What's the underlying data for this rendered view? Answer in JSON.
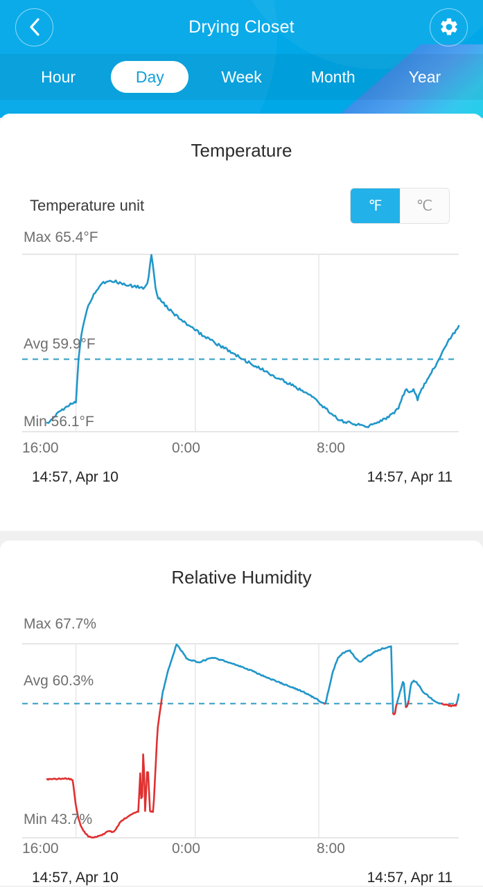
{
  "header": {
    "title": "Drying Closet",
    "back_icon": "chevron-left-icon",
    "settings_icon": "gear-icon",
    "bg_color": "#00a8e8",
    "tabs": [
      {
        "label": "Hour",
        "active": false
      },
      {
        "label": "Day",
        "active": true
      },
      {
        "label": "Week",
        "active": false
      },
      {
        "label": "Month",
        "active": false
      },
      {
        "label": "Year",
        "active": false
      }
    ]
  },
  "temperature_card": {
    "title": "Temperature",
    "unit_setting_label": "Temperature unit",
    "unit_options": [
      {
        "label": "℉",
        "selected": true
      },
      {
        "label": "℃",
        "selected": false
      }
    ],
    "max_label": "Max 65.4°F",
    "avg_label": "Avg 59.9°F",
    "min_label": "Min 56.1°F",
    "x_ticks": [
      "16:00",
      "0:00",
      "8:00"
    ],
    "range_start": "14:57,  Apr 10",
    "range_end": "14:57,  Apr 11",
    "line_color": "#2196c9",
    "avg_line_color": "#2e9bc4"
  },
  "humidity_card": {
    "title": "Relative Humidity",
    "max_label": "Max 67.7%",
    "avg_label": "Avg 60.3%",
    "min_label": "Min 43.7%",
    "x_ticks": [
      "16:00",
      "0:00",
      "8:00"
    ],
    "range_start": "14:57,  Apr 10",
    "range_end": "14:57,  Apr 11",
    "line_color": "#2196c9",
    "below_avg_color": "#e03030",
    "avg_line_color": "#2e9bc4"
  },
  "chart_data": [
    {
      "type": "line",
      "title": "Temperature",
      "xlabel": "",
      "ylabel": "°F",
      "unit": "°F",
      "max": 65.4,
      "avg": 59.9,
      "min": 56.1,
      "ylim": [
        56.1,
        65.4
      ],
      "x_tick_labels": [
        "16:00",
        "0:00",
        "8:00"
      ],
      "x_tick_positions": [
        0.07,
        0.36,
        0.66
      ],
      "x_start": "14:57, Apr 10",
      "x_end": "14:57, Apr 11",
      "grid": true,
      "legend": "none",
      "avg_reference_line": 59.9,
      "x": [
        0.0,
        0.018,
        0.036,
        0.05,
        0.062,
        0.07,
        0.074,
        0.078,
        0.082,
        0.09,
        0.1,
        0.115,
        0.13,
        0.15,
        0.17,
        0.19,
        0.205,
        0.22,
        0.235,
        0.245,
        0.253,
        0.258,
        0.263,
        0.27,
        0.28,
        0.295,
        0.315,
        0.34,
        0.365,
        0.39,
        0.42,
        0.45,
        0.48,
        0.51,
        0.545,
        0.58,
        0.615,
        0.65,
        0.672,
        0.69,
        0.705,
        0.72,
        0.74,
        0.76,
        0.78,
        0.8,
        0.82,
        0.84,
        0.855,
        0.865,
        0.872,
        0.88,
        0.89,
        0.9,
        0.915,
        0.935,
        0.955,
        0.975,
        1.0
      ],
      "y": [
        56.55,
        56.95,
        57.2,
        57.45,
        57.6,
        57.7,
        59.05,
        60.35,
        61.0,
        61.85,
        62.75,
        63.35,
        63.85,
        64.05,
        63.95,
        63.8,
        63.75,
        63.7,
        63.6,
        63.9,
        65.4,
        64.65,
        63.65,
        63.15,
        62.9,
        62.55,
        62.15,
        61.7,
        61.35,
        61.0,
        60.6,
        60.25,
        59.85,
        59.5,
        59.1,
        58.7,
        58.3,
        57.85,
        57.4,
        57.05,
        56.8,
        56.65,
        56.55,
        56.45,
        56.4,
        56.55,
        56.75,
        57.05,
        57.4,
        58.0,
        58.35,
        58.1,
        58.35,
        57.8,
        58.55,
        59.25,
        60.0,
        60.9,
        61.6
      ]
    },
    {
      "type": "line",
      "title": "Relative Humidity",
      "xlabel": "",
      "ylabel": "%",
      "unit": "%",
      "max": 67.7,
      "avg": 60.3,
      "min": 43.7,
      "ylim": [
        43.7,
        67.7
      ],
      "x_tick_labels": [
        "16:00",
        "0:00",
        "8:00"
      ],
      "x_tick_positions": [
        0.07,
        0.36,
        0.66
      ],
      "x_start": "14:57, Apr 10",
      "x_end": "14:57, Apr 11",
      "grid": true,
      "legend": "none",
      "avg_reference_line": 60.3,
      "split_color_at_avg": true,
      "x": [
        0.0,
        0.01,
        0.02,
        0.03,
        0.042,
        0.055,
        0.062,
        0.066,
        0.07,
        0.076,
        0.084,
        0.092,
        0.1,
        0.11,
        0.12,
        0.13,
        0.14,
        0.15,
        0.162,
        0.172,
        0.18,
        0.186,
        0.19,
        0.194,
        0.198,
        0.202,
        0.206,
        0.21,
        0.214,
        0.218,
        0.222,
        0.226,
        0.23,
        0.234,
        0.238,
        0.244,
        0.25,
        0.258,
        0.268,
        0.28,
        0.295,
        0.315,
        0.34,
        0.37,
        0.4,
        0.43,
        0.465,
        0.5,
        0.54,
        0.58,
        0.62,
        0.65,
        0.668,
        0.676,
        0.684,
        0.694,
        0.706,
        0.72,
        0.735,
        0.748,
        0.76,
        0.772,
        0.786,
        0.8,
        0.815,
        0.828,
        0.836,
        0.84,
        0.844,
        0.848,
        0.854,
        0.86,
        0.866,
        0.872,
        0.878,
        0.884,
        0.89,
        0.896,
        0.904,
        0.912,
        0.922,
        0.934,
        0.948,
        0.962,
        0.974,
        0.982,
        0.988,
        0.994,
        1.0
      ],
      "y": [
        50.9,
        51.0,
        50.95,
        51.0,
        51.05,
        50.95,
        50.9,
        49.2,
        47.6,
        46.1,
        44.9,
        44.3,
        43.9,
        43.7,
        43.8,
        44.0,
        44.25,
        44.55,
        44.4,
        45.2,
        45.8,
        46.0,
        46.1,
        46.25,
        46.4,
        46.55,
        46.65,
        46.75,
        46.8,
        46.9,
        47.0,
        52.0,
        46.7,
        55.5,
        46.9,
        53.0,
        47.0,
        46.85,
        57.0,
        61.5,
        64.6,
        67.7,
        65.8,
        65.4,
        66.0,
        65.6,
        65.0,
        64.3,
        63.4,
        62.6,
        61.8,
        61.0,
        60.4,
        60.3,
        62.0,
        64.2,
        65.9,
        66.6,
        66.9,
        66.0,
        65.4,
        65.9,
        66.4,
        66.8,
        67.1,
        67.3,
        67.35,
        59.2,
        58.8,
        60.0,
        61.1,
        62.2,
        63.2,
        59.6,
        60.5,
        62.8,
        63.1,
        63.0,
        62.5,
        61.8,
        61.4,
        60.9,
        60.4,
        60.2,
        60.1,
        60.0,
        60.05,
        60.1,
        61.4
      ]
    }
  ]
}
